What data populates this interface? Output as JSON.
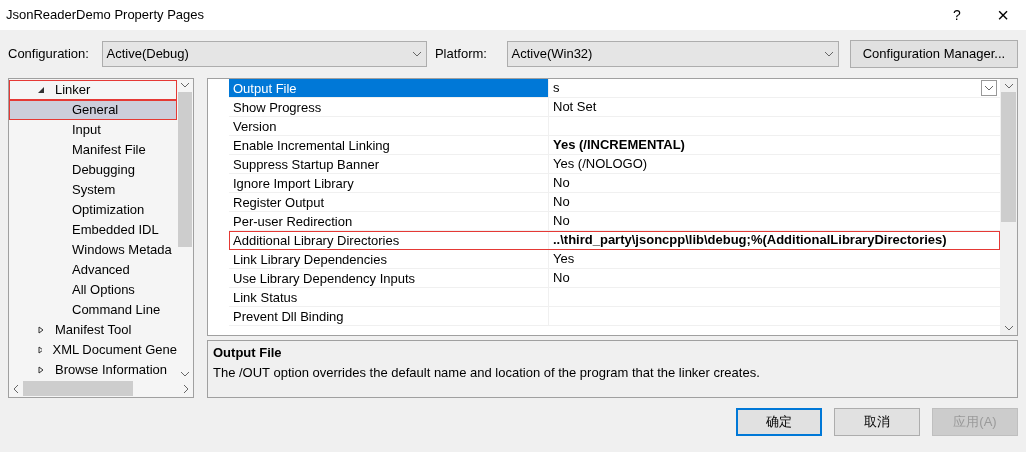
{
  "window": {
    "title": "JsonReaderDemo Property Pages",
    "help": "?",
    "close": "×"
  },
  "configuration": {
    "label": "Configuration:",
    "value": "Active(Debug)"
  },
  "platform": {
    "label": "Platform:",
    "value": "Active(Win32)"
  },
  "config_manager_button": "Configuration Manager...",
  "tree": [
    {
      "label": "Linker",
      "expanded": true,
      "selected": false,
      "highlighted": true,
      "children": [
        {
          "label": "General",
          "selected": true,
          "highlighted": true
        },
        {
          "label": "Input",
          "selected": false,
          "highlighted": false
        },
        {
          "label": "Manifest File",
          "selected": false,
          "highlighted": false
        },
        {
          "label": "Debugging",
          "selected": false,
          "highlighted": false
        },
        {
          "label": "System",
          "selected": false,
          "highlighted": false
        },
        {
          "label": "Optimization",
          "selected": false,
          "highlighted": false
        },
        {
          "label": "Embedded IDL",
          "selected": false,
          "highlighted": false
        },
        {
          "label": "Windows Metada",
          "selected": false,
          "highlighted": false
        },
        {
          "label": "Advanced",
          "selected": false,
          "highlighted": false
        },
        {
          "label": "All Options",
          "selected": false,
          "highlighted": false
        },
        {
          "label": "Command Line",
          "selected": false,
          "highlighted": false
        }
      ]
    },
    {
      "label": "Manifest Tool",
      "expanded": false,
      "selected": false,
      "highlighted": false
    },
    {
      "label": "XML Document Gene",
      "expanded": false,
      "selected": false,
      "highlighted": false
    },
    {
      "label": "Browse Information",
      "expanded": false,
      "selected": false,
      "highlighted": false
    }
  ],
  "properties": [
    {
      "name": "Output File",
      "value": "s",
      "bold": false,
      "selected": true,
      "highlighted": false
    },
    {
      "name": "Show Progress",
      "value": "Not Set",
      "bold": false,
      "selected": false,
      "highlighted": false
    },
    {
      "name": "Version",
      "selected": false,
      "highlighted": false
    },
    {
      "name": "Enable Incremental Linking",
      "value": "Yes (/INCREMENTAL)",
      "bold": true,
      "selected": false,
      "highlighted": false
    },
    {
      "name": "Suppress Startup Banner",
      "value": "Yes (/NOLOGO)",
      "bold": false,
      "selected": false,
      "highlighted": false
    },
    {
      "name": "Ignore Import Library",
      "value": "No",
      "bold": false,
      "selected": false,
      "highlighted": false
    },
    {
      "name": "Register Output",
      "value": "No",
      "bold": false,
      "selected": false,
      "highlighted": false
    },
    {
      "name": "Per-user Redirection",
      "value": "No",
      "bold": false,
      "selected": false,
      "highlighted": false
    },
    {
      "name": "Additional Library Directories",
      "value": "..\\third_party\\jsoncpp\\lib\\debug;%(AdditionalLibraryDirectories)",
      "bold": true,
      "selected": false,
      "highlighted": true
    },
    {
      "name": "Link Library Dependencies",
      "value": "Yes",
      "bold": false,
      "selected": false,
      "highlighted": false
    },
    {
      "name": "Use Library Dependency Inputs",
      "value": "No",
      "bold": false,
      "selected": false,
      "highlighted": false
    },
    {
      "name": "Link Status",
      "selected": false,
      "highlighted": false
    },
    {
      "name": "Prevent Dll Binding",
      "selected": false,
      "highlighted": false
    }
  ],
  "description": {
    "title": "Output File",
    "text": "The /OUT option overrides the default name and location of the program that the linker creates."
  },
  "buttons": [
    {
      "label": "确定",
      "kind": "default",
      "disabled": false
    },
    {
      "label": "取消",
      "kind": "normal",
      "disabled": false
    },
    {
      "label": "应用(A)",
      "kind": "normal",
      "disabled": true
    }
  ]
}
